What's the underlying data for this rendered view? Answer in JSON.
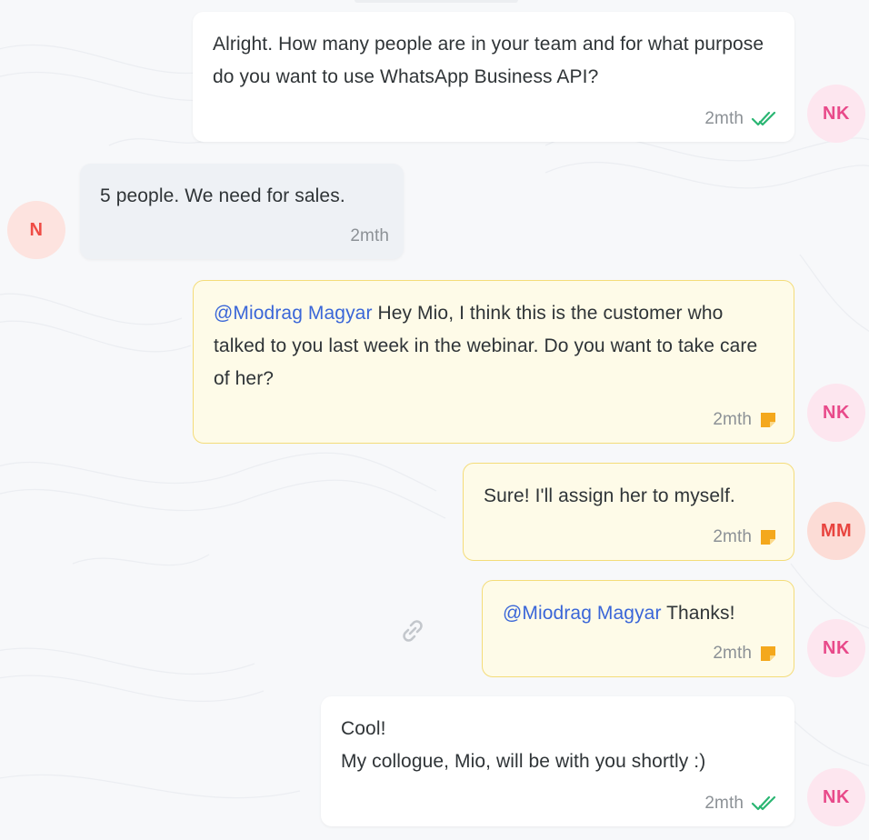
{
  "messages": [
    {
      "id": "m1",
      "type": "outgoing",
      "text": "Alright. How many people are in your team and for what purpose do you want to use WhatsApp Business API?",
      "time": "2mth",
      "status_icon": "double-check-icon",
      "avatar": "NK"
    },
    {
      "id": "m2",
      "type": "incoming",
      "text": "5 people. We need for sales.",
      "time": "2mth",
      "avatar": "N"
    },
    {
      "id": "m3",
      "type": "internal-note",
      "mention": "@Miodrag Magyar",
      "text": " Hey Mio, I think this is the customer who talked to you last week in the webinar. Do you want to take care of her?",
      "time": "2mth",
      "status_icon": "note-icon",
      "avatar": "NK"
    },
    {
      "id": "m4",
      "type": "internal-note",
      "text": "Sure! I'll assign her to myself.",
      "time": "2mth",
      "status_icon": "note-icon",
      "avatar": "MM"
    },
    {
      "id": "m5",
      "type": "internal-note",
      "mention": "@Miodrag Magyar",
      "text": " Thanks!",
      "time": "2mth",
      "status_icon": "note-icon",
      "avatar": "NK",
      "hover_action_icon": "link-icon"
    },
    {
      "id": "m6",
      "type": "outgoing",
      "text_line1": "Cool!",
      "text_line2": "My collogue, Mio, will be with you shortly :)",
      "time": "2mth",
      "status_icon": "double-check-icon",
      "avatar": "NK"
    }
  ],
  "colors": {
    "background": "#f7f8fa",
    "outgoing_bubble": "#ffffff",
    "incoming_bubble": "#eef1f5",
    "note_bubble": "#fefbe8",
    "note_border": "#f4dc7a",
    "mention": "#3a66d8",
    "read_ticks": "#2bb673",
    "note_icon": "#f4a81d"
  }
}
